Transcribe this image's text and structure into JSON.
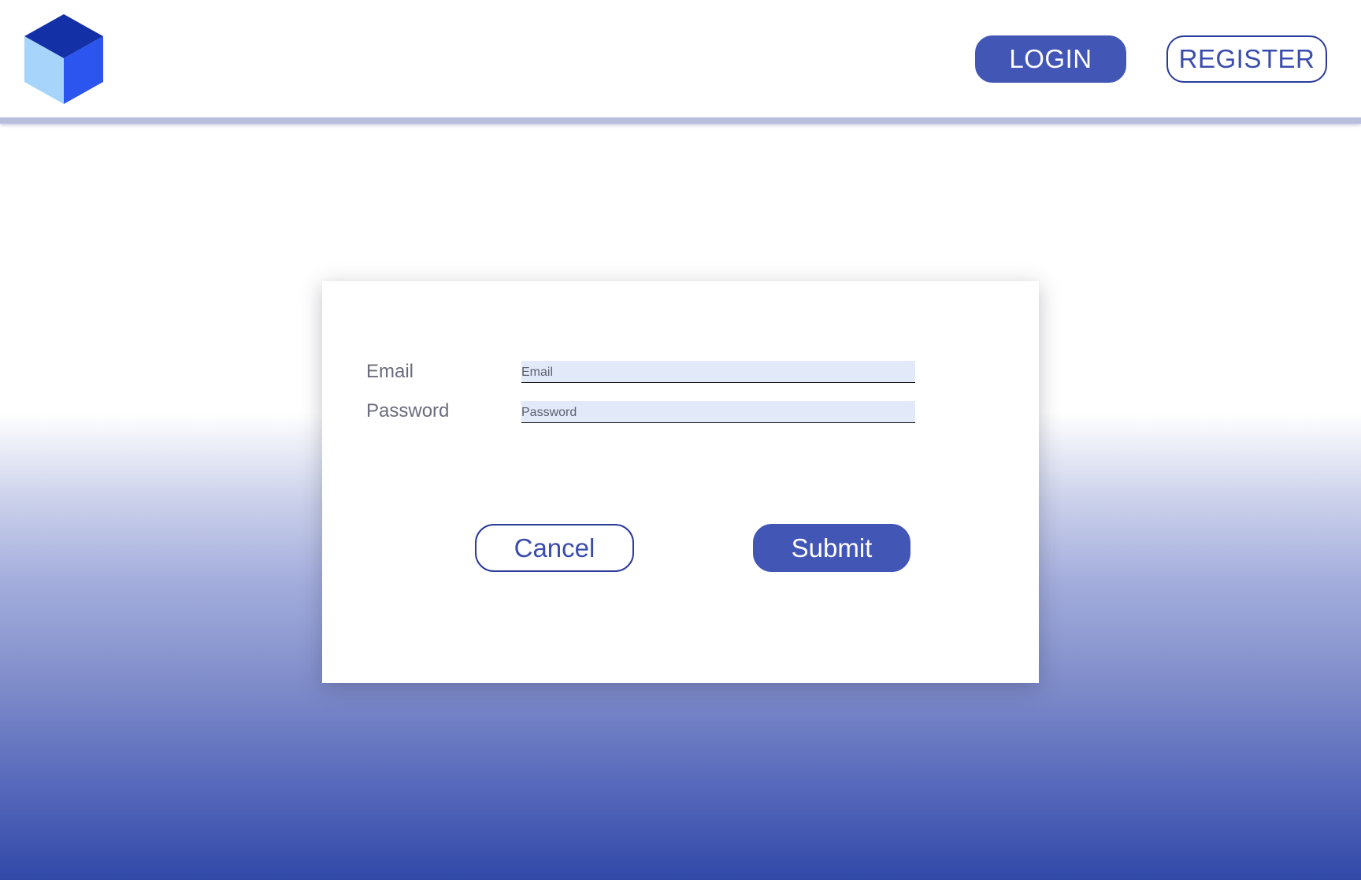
{
  "header": {
    "logo_icon": "cube-icon",
    "nav": {
      "login_label": "LOGIN",
      "register_label": "REGISTER"
    }
  },
  "login_form": {
    "email": {
      "label": "Email",
      "placeholder": "Email",
      "value": ""
    },
    "password": {
      "label": "Password",
      "placeholder": "Password",
      "value": ""
    },
    "cancel_label": "Cancel",
    "submit_label": "Submit"
  },
  "colors": {
    "accent": "#4256b6",
    "accent_dark": "#2a3a98",
    "input_background": "#e2e9f8",
    "label_text": "#6c6c7e",
    "gradient_bottom": "#3149a8"
  }
}
